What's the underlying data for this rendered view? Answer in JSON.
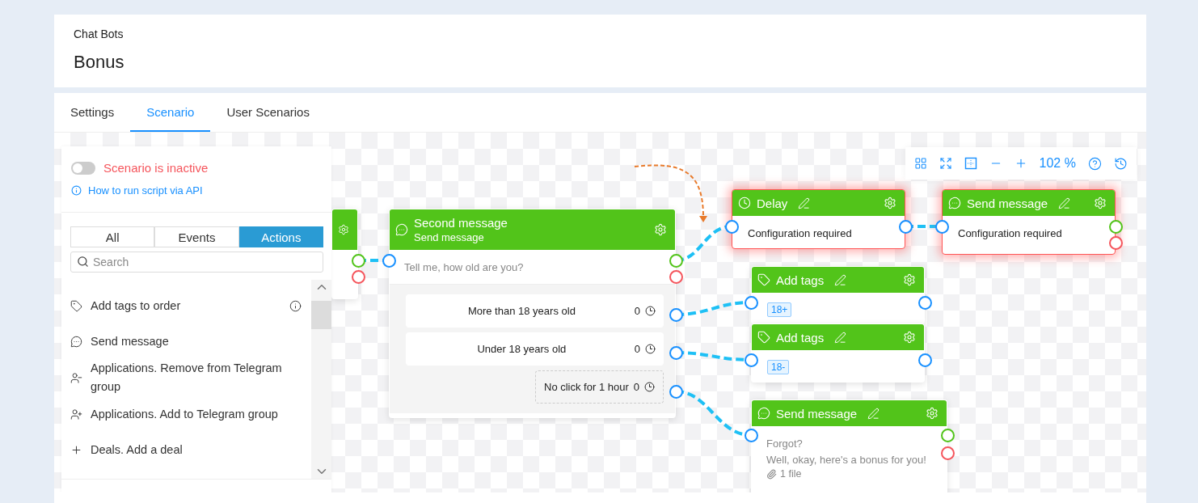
{
  "header": {
    "breadcrumb": "Chat Bots",
    "title": "Bonus"
  },
  "tabs": [
    {
      "label": "Settings",
      "selected": false
    },
    {
      "label": "Scenario",
      "selected": true
    },
    {
      "label": "User Scenarios",
      "selected": false
    }
  ],
  "panel": {
    "status": {
      "label": "Scenario is inactive",
      "on": false
    },
    "help_link": "How to run script via API",
    "filters": [
      {
        "label": "All",
        "selected": false
      },
      {
        "label": "Events",
        "selected": false
      },
      {
        "label": "Actions",
        "selected": true
      }
    ],
    "search": {
      "placeholder": "Search"
    },
    "items": [
      {
        "kind": "tag",
        "label": "Add tags to order",
        "info": true
      },
      {
        "kind": "message",
        "label": "Send message",
        "info": false
      },
      {
        "kind": "user-remove",
        "label": "Applications. Remove from Telegram group",
        "info": false
      },
      {
        "kind": "user-add",
        "label": "Applications. Add to Telegram group",
        "info": false
      },
      {
        "kind": "plus",
        "label": "Deals. Add a deal",
        "info": false
      }
    ]
  },
  "toolbar": {
    "zoom": "102 %"
  },
  "nodes": [
    {
      "kind": "stub",
      "error": false
    },
    {
      "kind": "message",
      "title": "Second message",
      "subtitle": "Send message",
      "lines": [
        "Tell me, how old are you?"
      ],
      "error": false,
      "renamable": false,
      "buttons": [
        {
          "kind": "reply",
          "label": "More than 18 years old",
          "count": "0"
        },
        {
          "kind": "reply",
          "label": "Under 18 years old",
          "count": "0"
        },
        {
          "kind": "timeout",
          "label": "No click for 1 hour",
          "count": "0"
        }
      ]
    },
    {
      "kind": "delay",
      "title": "Delay",
      "status": "Configuration required",
      "error": true,
      "renamable": true
    },
    {
      "kind": "message",
      "title": "Send message",
      "status": "Configuration required",
      "error": true,
      "renamable": true
    },
    {
      "kind": "tags",
      "title": "Add tags",
      "tags": [
        "18+"
      ],
      "error": false,
      "renamable": true
    },
    {
      "kind": "tags",
      "title": "Add tags",
      "tags": [
        "18-"
      ],
      "error": false,
      "renamable": true
    },
    {
      "kind": "message",
      "title": "Send message",
      "lines": [
        "Forgot?",
        "Well, okay, here's a bonus for you!"
      ],
      "attachment": "1 file",
      "error": false,
      "renamable": true
    }
  ]
}
